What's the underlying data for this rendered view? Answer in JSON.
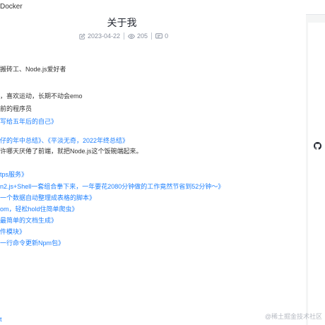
{
  "header": {
    "nav_label": "Docker"
  },
  "article": {
    "title": "关于我",
    "date": "2023-04-22",
    "views": "205",
    "comments": "0",
    "lines": [
      {
        "text": "搬砖工、Node.js爱好者",
        "link": false
      },
      {
        "text": "，喜欢运动，长期不动会emo",
        "link": false
      },
      {
        "text": "前的程序员",
        "link": false
      },
      {
        "text": "写给五年后的自己》",
        "link": true
      },
      {
        "text": "仔的年中总结》、《平淡无奇，2022年终总结》",
        "link": true
      },
      {
        "text": "许哪天厌倦了前端，就把Node.js这个饭碗端起来。",
        "link": false
      },
      {
        "text": "tps服务》",
        "link": true
      },
      {
        "text": "n2.js+Shell一套组合拳下来，一年要花2080分钟做的工作竟然节省到52分钟～》",
        "link": true
      },
      {
        "text": "一个数据自动整理成表格的脚本》",
        "link": true
      },
      {
        "text": "om，轻松hold住简单爬虫》",
        "link": true
      },
      {
        "text": "最简单的文档生成》",
        "link": true
      },
      {
        "text": "件模块》",
        "link": true
      },
      {
        "text": "一行命令更新Npm包》",
        "link": true
      },
      {
        "text": "t",
        "link": true
      }
    ]
  },
  "icons": {
    "date": "edit-icon",
    "views": "eye-icon",
    "comments": "comment-icon",
    "sidebar": "github-icon"
  },
  "colors": {
    "link": "#1e80ff",
    "meta": "#8a919f",
    "background": "#f4f5f5"
  },
  "watermark": "@稀土掘金技术社区"
}
